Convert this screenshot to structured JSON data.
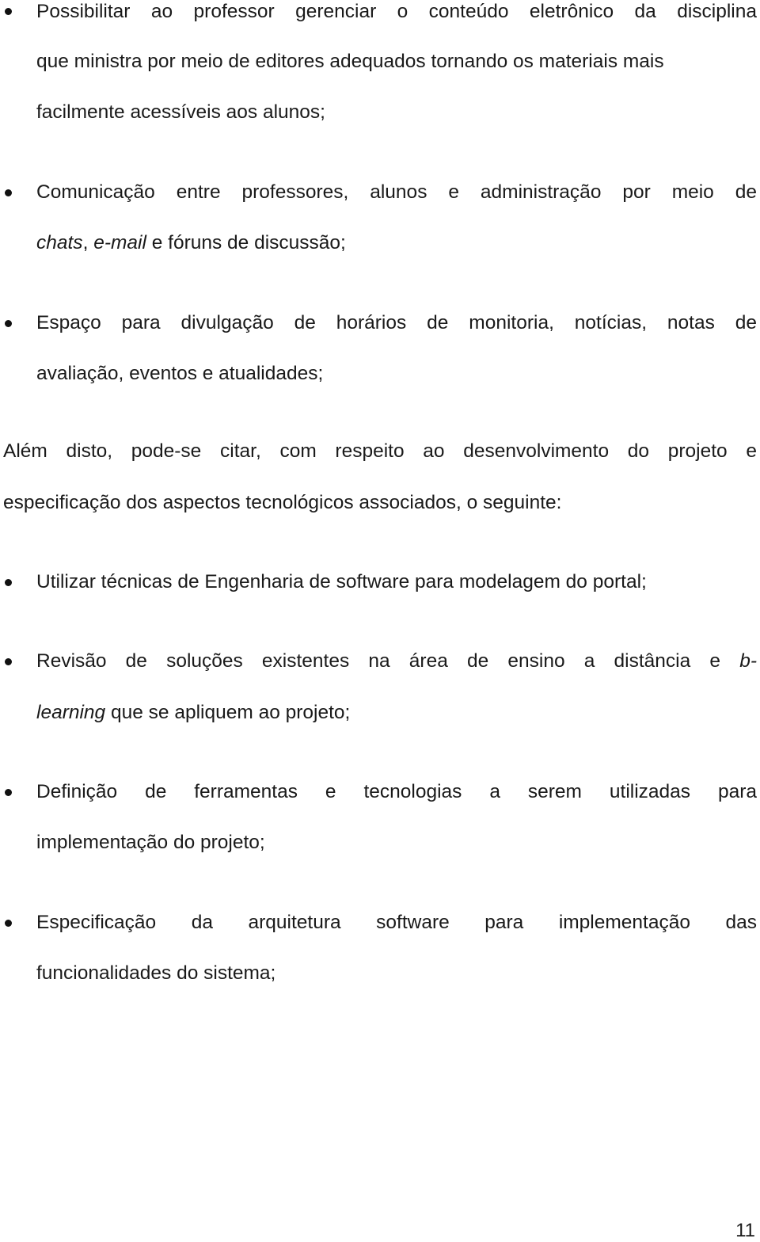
{
  "list_1": [
    {
      "lines": [
        "Possibilitar ao professor gerenciar o conteúdo eletrônico da disciplina",
        "que ministra por meio de editores adequados tornando os materiais mais",
        "facilmente acessíveis aos alunos;"
      ]
    },
    {
      "lines": [
        "Comunicação entre professores, alunos e administração por meio de"
      ],
      "line2": {
        "italic_1": "chats",
        "sep_1": ", ",
        "italic_2": "e-mail",
        "rest": " e fóruns de discussão;"
      }
    },
    {
      "lines": [
        "Espaço para divulgação de horários de monitoria, notícias, notas de",
        "avaliação, eventos e atualidades;"
      ]
    }
  ],
  "paragraph": {
    "lines": [
      "Além disto, pode-se citar, com respeito ao desenvolvimento do projeto e",
      "especificação dos aspectos tecnológicos associados, o seguinte:"
    ]
  },
  "list_2": [
    {
      "lines": [
        "Utilizar técnicas de Engenharia de software para modelagem do portal;"
      ]
    },
    {
      "line1": {
        "text": "Revisão de soluções existentes na área de ensino a distância e ",
        "italic_end": "b-"
      },
      "line2": {
        "italic_start": "learning",
        "rest": " que se apliquem ao projeto;"
      }
    },
    {
      "lines": [
        "Definição de ferramentas e tecnologias a serem utilizadas para",
        "implementação do projeto;"
      ]
    },
    {
      "lines": [
        "Especificação da arquitetura software para implementação das",
        "funcionalidades do sistema;"
      ]
    }
  ],
  "page_number": "11"
}
